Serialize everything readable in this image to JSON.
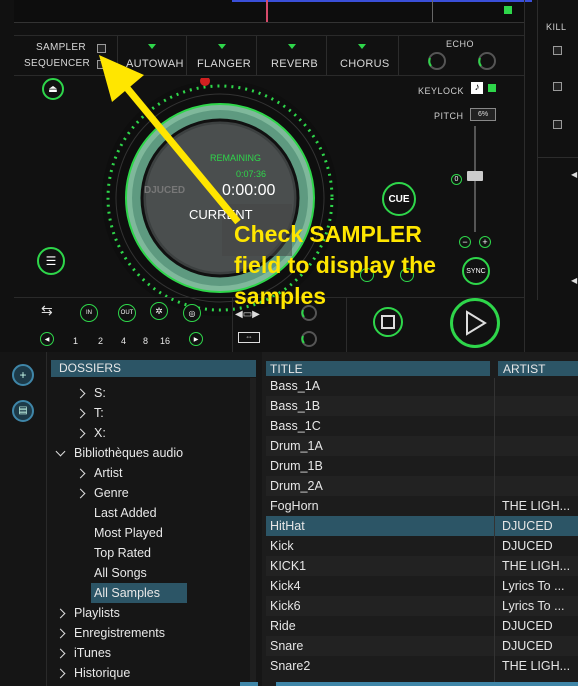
{
  "deck": {
    "sampler_label": "SAMPLER",
    "sequencer_label": "SEQUENCER",
    "effects": [
      "AUTOWAH",
      "FLANGER",
      "REVERB",
      "CHORUS"
    ],
    "echo_label": "ECHO",
    "kill_label": "KILL",
    "keylock_label": "KEYLOCK",
    "pitch_label": "PITCH",
    "pitch_value": "6%",
    "pitch_zero": "0",
    "remaining_label": "REMAINING",
    "remaining_time": "0:07:36",
    "current_time": "0:00:00",
    "current_label": "CURRENT",
    "platter_logo": "DJUCED",
    "cue_label": "CUE",
    "sync_label": "SYNC",
    "loop_in": "IN",
    "loop_out": "OUT",
    "loop_sizes": [
      "1",
      "2",
      "4",
      "8",
      "16"
    ]
  },
  "callout": {
    "line1": "Check SAMPLER",
    "line2": "field to display the",
    "line3": "samples",
    "color": "#ffe600"
  },
  "browser": {
    "folders_header": "DOSSIERS",
    "tree": [
      {
        "label": "S:",
        "level": 1,
        "chevron": "right"
      },
      {
        "label": "T:",
        "level": 1,
        "chevron": "right"
      },
      {
        "label": "X:",
        "level": 1,
        "chevron": "right"
      },
      {
        "label": "Bibliothèques audio",
        "level": 0,
        "chevron": "down"
      },
      {
        "label": "Artist",
        "level": 1,
        "chevron": "right"
      },
      {
        "label": "Genre",
        "level": 1,
        "chevron": "right"
      },
      {
        "label": "Last Added",
        "level": 2,
        "chevron": ""
      },
      {
        "label": "Most Played",
        "level": 2,
        "chevron": ""
      },
      {
        "label": "Top Rated",
        "level": 2,
        "chevron": ""
      },
      {
        "label": "All Songs",
        "level": 2,
        "chevron": ""
      },
      {
        "label": "All Samples",
        "level": 2,
        "chevron": "",
        "selected": true
      },
      {
        "label": "Playlists",
        "level": 0,
        "chevron": "right"
      },
      {
        "label": "Enregistrements",
        "level": 0,
        "chevron": "right"
      },
      {
        "label": "iTunes",
        "level": 0,
        "chevron": "right"
      },
      {
        "label": "Historique",
        "level": 0,
        "chevron": "right"
      }
    ],
    "columns": {
      "title": "TITLE",
      "artist": "ARTIST"
    },
    "tracks": [
      {
        "title": "Bass_1A",
        "artist": ""
      },
      {
        "title": "Bass_1B",
        "artist": ""
      },
      {
        "title": "Bass_1C",
        "artist": ""
      },
      {
        "title": "Drum_1A",
        "artist": ""
      },
      {
        "title": "Drum_1B",
        "artist": ""
      },
      {
        "title": "Drum_2A",
        "artist": ""
      },
      {
        "title": "FogHorn",
        "artist": "THE LIGH..."
      },
      {
        "title": "HitHat",
        "artist": "DJUCED",
        "selected": true
      },
      {
        "title": "Kick",
        "artist": "DJUCED"
      },
      {
        "title": "KICK1",
        "artist": "THE LIGH..."
      },
      {
        "title": "Kick4",
        "artist": "Lyrics To ..."
      },
      {
        "title": "Kick6",
        "artist": "Lyrics To ..."
      },
      {
        "title": "Ride",
        "artist": "DJUCED"
      },
      {
        "title": "Snare",
        "artist": "DJUCED"
      },
      {
        "title": "Snare2",
        "artist": "THE LIGH..."
      }
    ]
  },
  "colors": {
    "accent_green": "#2ed64a",
    "selection_blue": "#2c5566",
    "callout_yellow": "#ffe600"
  }
}
